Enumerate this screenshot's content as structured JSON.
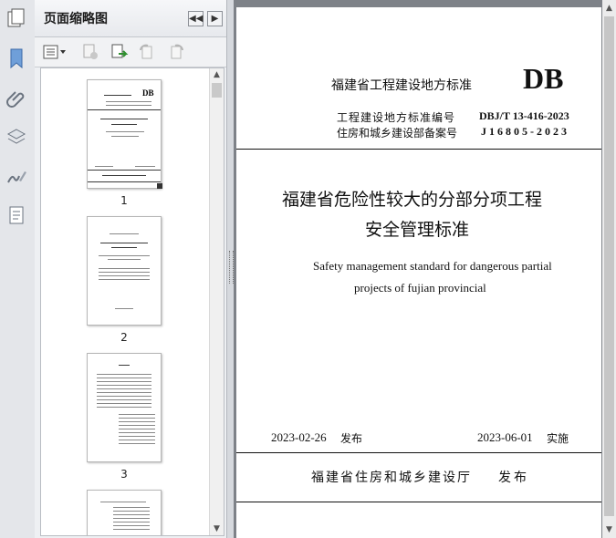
{
  "thumbnail_panel": {
    "title": "页面缩略图",
    "collapse_btn": "◀◀",
    "expand_btn": "▶",
    "pages": [
      {
        "number": "1"
      },
      {
        "number": "2"
      },
      {
        "number": "3"
      }
    ]
  },
  "document": {
    "header_left": "福建省工程建设地方标准",
    "header_logo": "DB",
    "code_label_1": "工程建设地方标准编号",
    "code_value_1": "DBJ/T 13-416-2023",
    "code_label_2": "住房和城乡建设部备案号",
    "code_value_2": "J16805-2023",
    "title_line_1": "福建省危险性较大的分部分项工程",
    "title_line_2": "安全管理标准",
    "en_title_line_1": "Safety management standard for dangerous partial",
    "en_title_line_2": "projects of fujian provincial",
    "publish_date": "2023-02-26",
    "publish_label": "发布",
    "effective_date": "2023-06-01",
    "effective_label": "实施",
    "publisher": "福建省住房和城乡建设厅",
    "publisher_action": "发布"
  },
  "colors": {
    "accent": "#2b6fd6",
    "doc_background": "#7e8288"
  },
  "icons": [
    "pages-icon",
    "bookmark-icon",
    "attachment-icon",
    "layers-icon",
    "signature-icon",
    "content-icon",
    "thumbnail-options-icon",
    "delete-page-icon",
    "insert-page-icon",
    "rotate-left-icon",
    "rotate-right-icon"
  ]
}
